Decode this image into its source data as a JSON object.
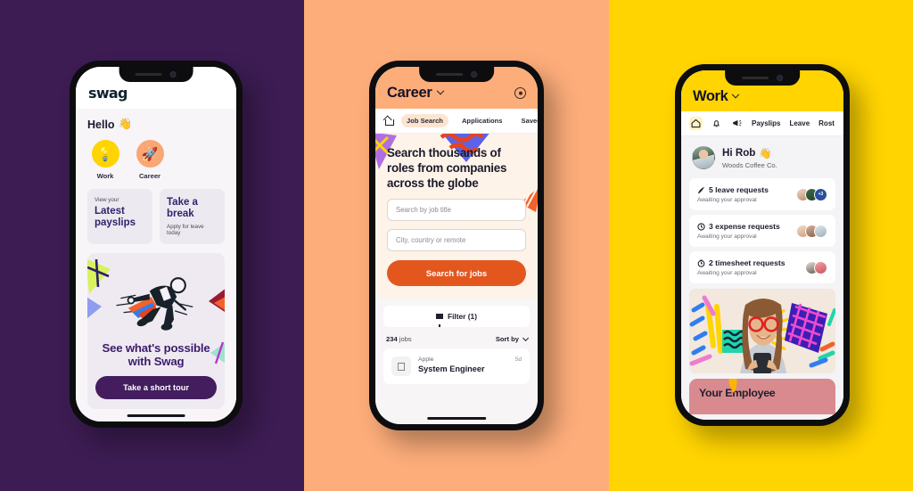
{
  "scene": {
    "panels": [
      {
        "name": "purple",
        "color": "#3c1c52"
      },
      {
        "name": "peach",
        "color": "#fdad7a"
      },
      {
        "name": "yellow",
        "color": "#ffd400"
      }
    ]
  },
  "phone_swag": {
    "logo": "swag",
    "greeting": "Hello",
    "greeting_emoji": "👋",
    "shortcuts": [
      {
        "label": "Work",
        "icon": "💡",
        "color": "#ffd400"
      },
      {
        "label": "Career",
        "icon": "🚀",
        "color": "#f8a775"
      }
    ],
    "tiles": [
      {
        "eyebrow": "View your",
        "title": "Latest payslips",
        "sub": ""
      },
      {
        "eyebrow": "",
        "title": "Take a break",
        "sub": "Apply for leave today"
      }
    ],
    "promo": {
      "title": "See what's possible with Swag",
      "button": "Take a short tour",
      "illustration": "rocket-rider-illustration"
    }
  },
  "phone_career": {
    "header_title": "Career",
    "header_icon": "account-icon",
    "tabs": [
      {
        "label": "Job Search",
        "active": true
      },
      {
        "label": "Applications",
        "active": false
      },
      {
        "label": "Saved J",
        "active": false
      }
    ],
    "hero_heading": "Search thousands of roles from companies across the globe",
    "fields": [
      {
        "placeholder": "Search by job title"
      },
      {
        "placeholder": "City, country or remote"
      }
    ],
    "search_button": "Search for jobs",
    "filter_label": "Filter (1)",
    "results_count": "234",
    "results_unit": "jobs",
    "sort_label": "Sort by",
    "jobs": [
      {
        "company": "Apple",
        "title": "System Engineer",
        "age": "5d",
        "logo": "apple-icon"
      }
    ]
  },
  "phone_work": {
    "header_title": "Work",
    "tabs": [
      {
        "icon": "home-icon",
        "label": "",
        "active": true
      },
      {
        "icon": "bell-icon",
        "label": "",
        "active": false
      },
      {
        "icon": "megaphone-icon",
        "label": "",
        "active": false
      },
      {
        "icon": "",
        "label": "Payslips",
        "active": false
      },
      {
        "icon": "",
        "label": "Leave",
        "active": false
      },
      {
        "icon": "",
        "label": "Rost",
        "active": false
      }
    ],
    "user": {
      "greeting": "Hi Rob",
      "emoji": "👋",
      "company": "Woods Coffee Co."
    },
    "requests": [
      {
        "icon": "leave-icon",
        "title": "5 leave requests",
        "sub": "Awaiting your approval",
        "extra": "+3"
      },
      {
        "icon": "expense-icon",
        "title": "3 expense requests",
        "sub": "Awaiting your approval",
        "extra": ""
      },
      {
        "icon": "timesheet-icon",
        "title": "2 timesheet requests",
        "sub": "Awaiting your approval",
        "extra": ""
      }
    ],
    "photo_alt": "woman-with-phone-photo",
    "bottom_card_title": "Your Employee"
  }
}
